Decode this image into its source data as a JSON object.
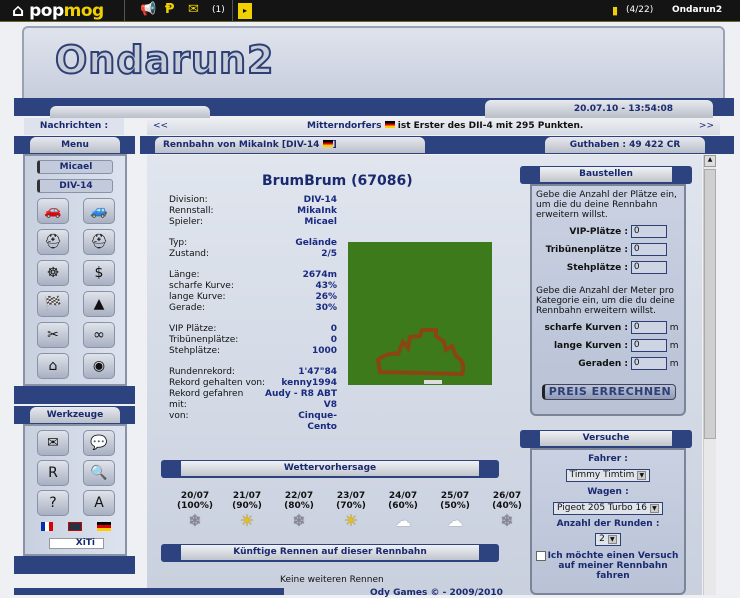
{
  "topbar": {
    "logo_a": "pop",
    "logo_b": "mog",
    "messages_count": "(1)",
    "credits": "(4/22)",
    "game": "Ondarun2"
  },
  "header": {
    "brand": "Ondarun2",
    "datetime": "20.07.10 - 13:54:08"
  },
  "news": {
    "label": "Nachrichten :",
    "prev": "<<",
    "next": ">>",
    "player": "Mitterndorfers",
    "message": "ist Erster des DII-4 mit 295 Punkten."
  },
  "menu": {
    "title": "Menu",
    "user": "Micael",
    "division": "DIV-14",
    "icons": [
      "car-icon",
      "car-sell-icon",
      "driver-helmet-icon",
      "driver-sell-icon",
      "steering-wheel-icon",
      "finance-icon",
      "checkered-flag-icon",
      "cone-icon",
      "tools-icon",
      "track-icon",
      "home-icon",
      "camera-icon"
    ]
  },
  "tools": {
    "title": "Werkzeuge",
    "icons": [
      "mail-icon",
      "chat-icon",
      "r-icon",
      "search-icon",
      "help-icon",
      "a-icon"
    ],
    "xiti": "XiTi"
  },
  "bar": {
    "prefix": "Rennbahn von",
    "owner": "MikaInk",
    "division": "[DIV-14",
    "division_end": "]",
    "balance": "Guthaben : 49 422 CR"
  },
  "track": {
    "title": "BrumBrum (67086)",
    "rows": [
      [
        [
          "Division:",
          "DIV-14"
        ],
        [
          "Rennstall:",
          "MikaInk"
        ],
        [
          "Spieler:",
          "Micael"
        ]
      ],
      [
        [
          "Typ:",
          "Gelände"
        ],
        [
          "Zustand:",
          "2/5"
        ]
      ],
      [
        [
          "Länge:",
          "2674m"
        ],
        [
          "scharfe Kurve:",
          "43%"
        ],
        [
          "lange Kurve:",
          "26%"
        ],
        [
          "Gerade:",
          "30%"
        ]
      ],
      [
        [
          "VIP Plätze:",
          "0"
        ],
        [
          "Tribünenplätze:",
          "0"
        ],
        [
          "Stehplätze:",
          "1000"
        ]
      ],
      [
        [
          "Rundenrekord:",
          "1'47\"84"
        ],
        [
          "Rekord gehalten von:",
          "kenny1994"
        ],
        [
          "Rekord gefahren mit:",
          "Audy - R8 ABT V8"
        ],
        [
          "von:",
          "Cinque-Cento"
        ]
      ]
    ]
  },
  "weather": {
    "title": "Wettervorhersage",
    "days": [
      {
        "date": "20/07",
        "pct": "(100%)",
        "icon": "snow"
      },
      {
        "date": "21/07",
        "pct": "(90%)",
        "icon": "sun"
      },
      {
        "date": "22/07",
        "pct": "(80%)",
        "icon": "snow"
      },
      {
        "date": "23/07",
        "pct": "(70%)",
        "icon": "sun"
      },
      {
        "date": "24/07",
        "pct": "(60%)",
        "icon": "cloud"
      },
      {
        "date": "25/07",
        "pct": "(50%)",
        "icon": "cloud"
      },
      {
        "date": "26/07",
        "pct": "(40%)",
        "icon": "snow"
      }
    ]
  },
  "races": {
    "title": "Künftige Rennen auf dieser Rennbahn",
    "empty": "Keine weiteren Rennen"
  },
  "build": {
    "title": "Baustellen",
    "intro1": "Gebe die Anzahl der Plätze ein, um die du deine Rennbahn erweitern willst.",
    "vip": "VIP-Plätze :",
    "trib": "Tribünenplätze :",
    "steh": "Stehplätze :",
    "intro2": "Gebe die Anzahl der Meter pro Kategorie ein, um die du deine Rennbahn erweitern willst.",
    "sharp": "scharfe Kurven :",
    "long": "lange Kurven :",
    "straight": "Geraden :",
    "unit": "m",
    "value": "0",
    "button": "PREIS ERRECHNEN"
  },
  "trial": {
    "title": "Versuche",
    "driver_label": "Fahrer :",
    "driver": "Timmy Timtim",
    "car_label": "Wagen :",
    "car": "Pigeot 205 Turbo 16",
    "laps_label": "Anzahl der Runden :",
    "laps": "2",
    "checkbox": "Ich möchte einen Versuch auf meiner Rennbahn fahren"
  },
  "footer": {
    "text": "Ody Games © - 2009/2010"
  }
}
